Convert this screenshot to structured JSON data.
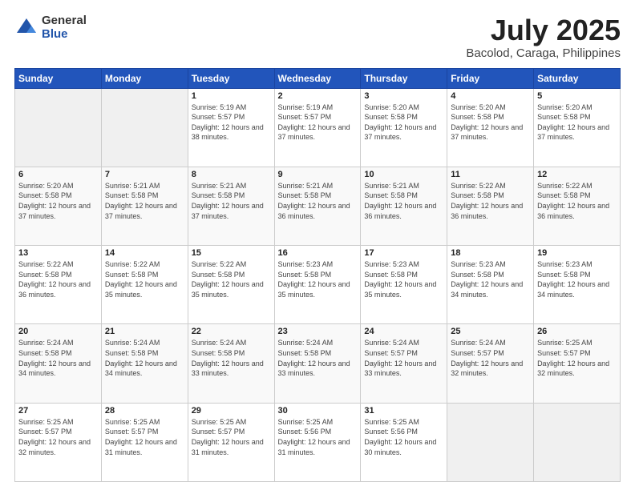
{
  "header": {
    "logo_general": "General",
    "logo_blue": "Blue",
    "title": "July 2025",
    "location": "Bacolod, Caraga, Philippines"
  },
  "weekdays": [
    "Sunday",
    "Monday",
    "Tuesday",
    "Wednesday",
    "Thursday",
    "Friday",
    "Saturday"
  ],
  "weeks": [
    [
      {
        "day": "",
        "info": ""
      },
      {
        "day": "",
        "info": ""
      },
      {
        "day": "1",
        "info": "Sunrise: 5:19 AM\nSunset: 5:57 PM\nDaylight: 12 hours\nand 38 minutes."
      },
      {
        "day": "2",
        "info": "Sunrise: 5:19 AM\nSunset: 5:57 PM\nDaylight: 12 hours\nand 37 minutes."
      },
      {
        "day": "3",
        "info": "Sunrise: 5:20 AM\nSunset: 5:58 PM\nDaylight: 12 hours\nand 37 minutes."
      },
      {
        "day": "4",
        "info": "Sunrise: 5:20 AM\nSunset: 5:58 PM\nDaylight: 12 hours\nand 37 minutes."
      },
      {
        "day": "5",
        "info": "Sunrise: 5:20 AM\nSunset: 5:58 PM\nDaylight: 12 hours\nand 37 minutes."
      }
    ],
    [
      {
        "day": "6",
        "info": "Sunrise: 5:20 AM\nSunset: 5:58 PM\nDaylight: 12 hours\nand 37 minutes."
      },
      {
        "day": "7",
        "info": "Sunrise: 5:21 AM\nSunset: 5:58 PM\nDaylight: 12 hours\nand 37 minutes."
      },
      {
        "day": "8",
        "info": "Sunrise: 5:21 AM\nSunset: 5:58 PM\nDaylight: 12 hours\nand 37 minutes."
      },
      {
        "day": "9",
        "info": "Sunrise: 5:21 AM\nSunset: 5:58 PM\nDaylight: 12 hours\nand 36 minutes."
      },
      {
        "day": "10",
        "info": "Sunrise: 5:21 AM\nSunset: 5:58 PM\nDaylight: 12 hours\nand 36 minutes."
      },
      {
        "day": "11",
        "info": "Sunrise: 5:22 AM\nSunset: 5:58 PM\nDaylight: 12 hours\nand 36 minutes."
      },
      {
        "day": "12",
        "info": "Sunrise: 5:22 AM\nSunset: 5:58 PM\nDaylight: 12 hours\nand 36 minutes."
      }
    ],
    [
      {
        "day": "13",
        "info": "Sunrise: 5:22 AM\nSunset: 5:58 PM\nDaylight: 12 hours\nand 36 minutes."
      },
      {
        "day": "14",
        "info": "Sunrise: 5:22 AM\nSunset: 5:58 PM\nDaylight: 12 hours\nand 35 minutes."
      },
      {
        "day": "15",
        "info": "Sunrise: 5:22 AM\nSunset: 5:58 PM\nDaylight: 12 hours\nand 35 minutes."
      },
      {
        "day": "16",
        "info": "Sunrise: 5:23 AM\nSunset: 5:58 PM\nDaylight: 12 hours\nand 35 minutes."
      },
      {
        "day": "17",
        "info": "Sunrise: 5:23 AM\nSunset: 5:58 PM\nDaylight: 12 hours\nand 35 minutes."
      },
      {
        "day": "18",
        "info": "Sunrise: 5:23 AM\nSunset: 5:58 PM\nDaylight: 12 hours\nand 34 minutes."
      },
      {
        "day": "19",
        "info": "Sunrise: 5:23 AM\nSunset: 5:58 PM\nDaylight: 12 hours\nand 34 minutes."
      }
    ],
    [
      {
        "day": "20",
        "info": "Sunrise: 5:24 AM\nSunset: 5:58 PM\nDaylight: 12 hours\nand 34 minutes."
      },
      {
        "day": "21",
        "info": "Sunrise: 5:24 AM\nSunset: 5:58 PM\nDaylight: 12 hours\nand 34 minutes."
      },
      {
        "day": "22",
        "info": "Sunrise: 5:24 AM\nSunset: 5:58 PM\nDaylight: 12 hours\nand 33 minutes."
      },
      {
        "day": "23",
        "info": "Sunrise: 5:24 AM\nSunset: 5:58 PM\nDaylight: 12 hours\nand 33 minutes."
      },
      {
        "day": "24",
        "info": "Sunrise: 5:24 AM\nSunset: 5:57 PM\nDaylight: 12 hours\nand 33 minutes."
      },
      {
        "day": "25",
        "info": "Sunrise: 5:24 AM\nSunset: 5:57 PM\nDaylight: 12 hours\nand 32 minutes."
      },
      {
        "day": "26",
        "info": "Sunrise: 5:25 AM\nSunset: 5:57 PM\nDaylight: 12 hours\nand 32 minutes."
      }
    ],
    [
      {
        "day": "27",
        "info": "Sunrise: 5:25 AM\nSunset: 5:57 PM\nDaylight: 12 hours\nand 32 minutes."
      },
      {
        "day": "28",
        "info": "Sunrise: 5:25 AM\nSunset: 5:57 PM\nDaylight: 12 hours\nand 31 minutes."
      },
      {
        "day": "29",
        "info": "Sunrise: 5:25 AM\nSunset: 5:57 PM\nDaylight: 12 hours\nand 31 minutes."
      },
      {
        "day": "30",
        "info": "Sunrise: 5:25 AM\nSunset: 5:56 PM\nDaylight: 12 hours\nand 31 minutes."
      },
      {
        "day": "31",
        "info": "Sunrise: 5:25 AM\nSunset: 5:56 PM\nDaylight: 12 hours\nand 30 minutes."
      },
      {
        "day": "",
        "info": ""
      },
      {
        "day": "",
        "info": ""
      }
    ]
  ]
}
